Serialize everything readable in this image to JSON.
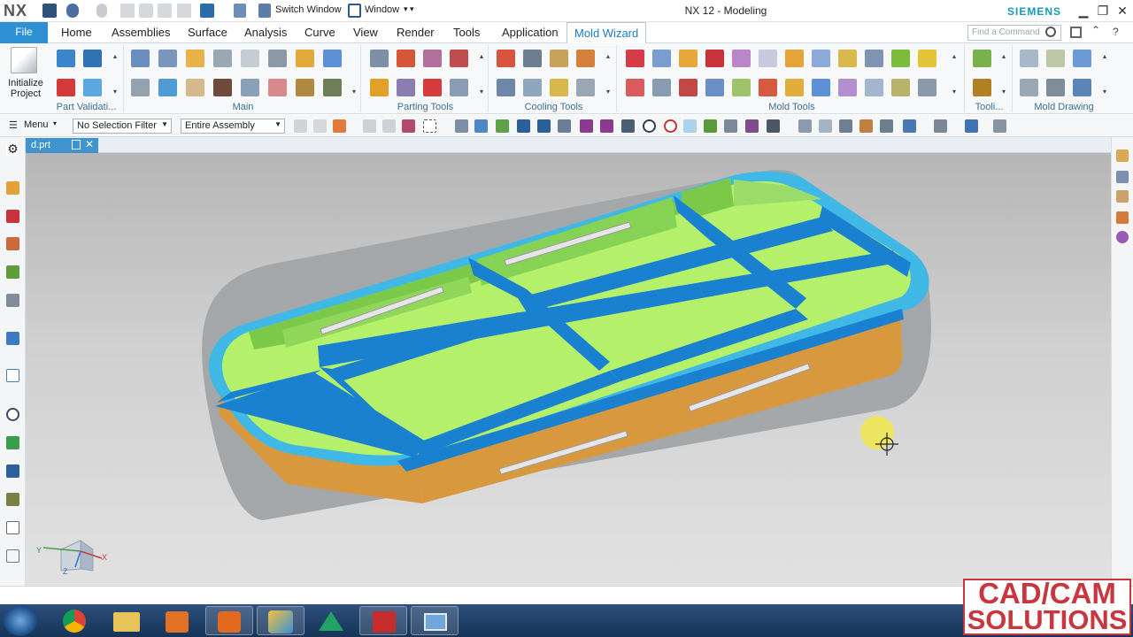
{
  "window": {
    "app": "NX",
    "title": "NX 12 - Modeling",
    "brand": "SIEMENS",
    "switch_window": "Switch Window",
    "window_menu": "Window"
  },
  "tabs": {
    "file": "File",
    "items": [
      "Home",
      "Assemblies",
      "Surface",
      "Analysis",
      "Curve",
      "View",
      "Render",
      "Tools",
      "Application",
      "Mold Wizard"
    ],
    "active": "Mold Wizard"
  },
  "command_finder": {
    "placeholder": "Find a Command"
  },
  "ribbon": {
    "init_project_line1": "Initialize",
    "init_project_line2": "Project",
    "groups": [
      "Part Validati...",
      "Main",
      "Parting Tools",
      "Cooling Tools",
      "Mold Tools",
      "Tooli...",
      "Mold Drawing"
    ]
  },
  "selection_bar": {
    "menu": "Menu",
    "filter": "No Selection Filter",
    "scope": "Entire Assembly"
  },
  "document": {
    "tab": "d.prt"
  },
  "watermark": {
    "line1": "CAD/CAM",
    "line2": "SOLUTIONS"
  },
  "colors": {
    "accent": "#2e8fd3",
    "walls_blue": "#1a80d0",
    "floor_green": "#b5f06b",
    "side_green": "#7cc94a",
    "side_orange": "#d8993e",
    "rim_cyan": "#3fb8e6",
    "watermark_red": "#c7373d"
  }
}
